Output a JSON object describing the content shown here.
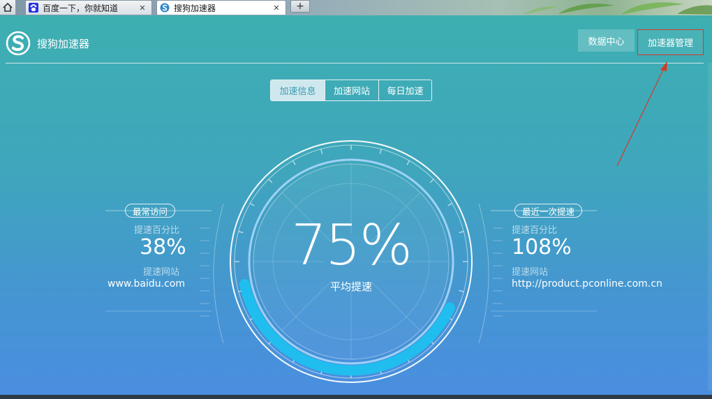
{
  "browser": {
    "tabs": [
      {
        "title": "百度一下，你就知道",
        "icon": "baidu-paw-icon",
        "active": false
      },
      {
        "title": "搜狗加速器",
        "icon": "sogou-logo-icon",
        "active": true
      }
    ],
    "close_glyph": "✕",
    "new_tab_glyph": "+"
  },
  "app": {
    "title": "搜狗加速器",
    "header_buttons": {
      "data_center": "数据中心",
      "manage": "加速器管理"
    },
    "tabs": [
      {
        "label": "加速信息",
        "active": true
      },
      {
        "label": "加速网站",
        "active": false
      },
      {
        "label": "每日加速",
        "active": false
      }
    ],
    "gauge": {
      "value": "75%",
      "label": "平均提速",
      "progress_fraction": 0.23
    },
    "left": {
      "badge": "最常访问",
      "pct_label": "提速百分比",
      "pct_value": "38%",
      "site_label": "提速网站",
      "site": "www.baidu.com"
    },
    "right": {
      "badge": "最近一次提速",
      "pct_label": "提速百分比",
      "pct_value": "108%",
      "site_label": "提速网站",
      "site": "http://product.pconline.com.cn"
    }
  },
  "colors": {
    "accent_top": "#3dafb1",
    "accent_bottom": "#4a8ee0",
    "progress": "#1fc0ef",
    "highlight_box": "#d23a2a"
  }
}
